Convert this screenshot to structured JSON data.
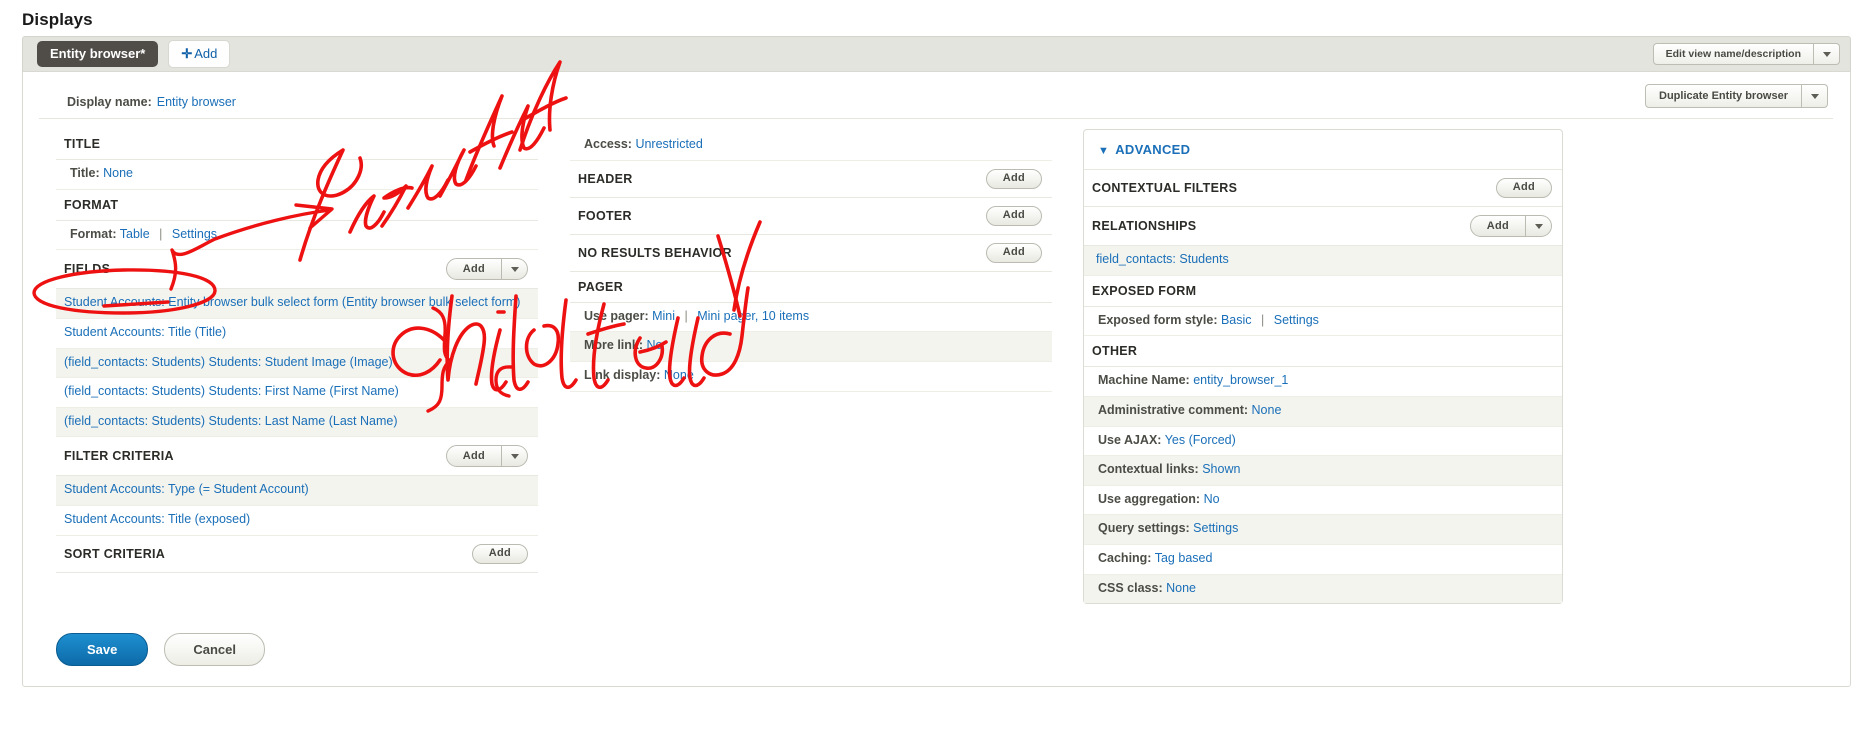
{
  "page": {
    "title": "Displays"
  },
  "tabstrip": {
    "active_display": "Entity browser*",
    "add_label": "Add",
    "add_icon": "plus-icon",
    "edit_view_button": "Edit view name/description",
    "edit_view_caret_icon": "chevron-down-icon"
  },
  "display_name": {
    "label": "Display name:",
    "value": "Entity browser",
    "duplicate_button": "Duplicate Entity browser",
    "duplicate_caret_icon": "chevron-down-icon"
  },
  "left_column": {
    "title_section": {
      "heading": "TITLE",
      "rows": [
        {
          "key": "Title:",
          "value": "None"
        }
      ]
    },
    "format_section": {
      "heading": "FORMAT",
      "rows": [
        {
          "key": "Format:",
          "value": "Table",
          "sep": "|",
          "value2": "Settings"
        }
      ]
    },
    "fields_section": {
      "heading": "FIELDS",
      "add_label": "Add",
      "add_caret_icon": "chevron-down-icon",
      "items": [
        "Student Accounts: Entity browser bulk select form (Entity browser bulk select form)",
        "Student Accounts: Title (Title)",
        "(field_contacts: Students) Students: Student Image (Image)",
        "(field_contacts: Students) Students: First Name (First Name)",
        "(field_contacts: Students) Students: Last Name (Last Name)"
      ]
    },
    "filter_section": {
      "heading": "FILTER CRITERIA",
      "add_label": "Add",
      "add_caret_icon": "chevron-down-icon",
      "items": [
        "Student Accounts: Type (= Student Account)",
        "Student Accounts: Title (exposed)"
      ]
    },
    "sort_section": {
      "heading": "SORT CRITERIA",
      "add_label": "Add",
      "items": []
    }
  },
  "middle_column": {
    "access_row": {
      "key": "Access:",
      "value": "Unrestricted"
    },
    "header_section": {
      "heading": "HEADER",
      "add_label": "Add"
    },
    "footer_section": {
      "heading": "FOOTER",
      "add_label": "Add"
    },
    "no_results_section": {
      "heading": "NO RESULTS BEHAVIOR",
      "add_label": "Add"
    },
    "pager_section": {
      "heading": "PAGER",
      "rows": [
        {
          "key": "Use pager:",
          "value": "Mini",
          "sep": "|",
          "value2": "Mini pager, 10 items"
        },
        {
          "key": "More link:",
          "value": "No"
        },
        {
          "key": "Link display:",
          "value": "None"
        }
      ]
    }
  },
  "right_column": {
    "advanced_heading": "ADVANCED",
    "advanced_toggle_icon": "triangle-down-icon",
    "contextual_filters": {
      "heading": "CONTEXTUAL FILTERS",
      "add_label": "Add"
    },
    "relationships": {
      "heading": "RELATIONSHIPS",
      "add_label": "Add",
      "add_caret_icon": "chevron-down-icon",
      "items": [
        "field_contacts: Students"
      ]
    },
    "exposed_form": {
      "heading": "EXPOSED FORM",
      "rows": [
        {
          "key": "Exposed form style:",
          "value": "Basic",
          "sep": "|",
          "value2": "Settings"
        }
      ]
    },
    "other": {
      "heading": "OTHER",
      "rows": [
        {
          "key": "Machine Name:",
          "value": "entity_browser_1"
        },
        {
          "key": "Administrative comment:",
          "value": "None"
        },
        {
          "key": "Use AJAX:",
          "value": "Yes (Forced)"
        },
        {
          "key": "Contextual links:",
          "value": "Shown"
        },
        {
          "key": "Use aggregation:",
          "value": "No"
        },
        {
          "key": "Query settings:",
          "value": "Settings"
        },
        {
          "key": "Caching:",
          "value": "Tag based"
        },
        {
          "key": "CSS class:",
          "value": "None"
        }
      ]
    }
  },
  "footer_actions": {
    "save_label": "Save",
    "cancel_label": "Cancel"
  },
  "annotations": {
    "ink_color": "#ee1111",
    "parent_label": "Parent field",
    "child_label": "child field"
  }
}
